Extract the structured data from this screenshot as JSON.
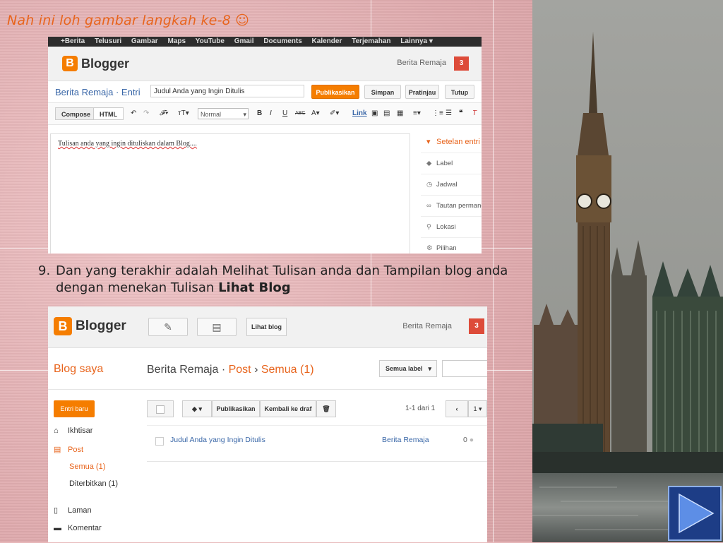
{
  "slide": {
    "heading": "Nah ini loh gambar langkah ke-8 ☺",
    "step_number": "9.",
    "step_text": "Dan yang terakhir adalah Melihat Tulisan anda dan Tampilan blog anda dengan menekan Tulisan ",
    "step_emphasis": "Lihat Blog"
  },
  "editor_shot": {
    "gbar": [
      "+Berita",
      "Telusuri",
      "Gambar",
      "Maps",
      "YouTube",
      "Gmail",
      "Documents",
      "Kalender",
      "Terjemahan",
      "Lainnya ▾"
    ],
    "logo_text": "Blogger",
    "logo_letter": "B",
    "user": "Berita Remaja",
    "notif_count": "3",
    "breadcrumb": "Berita Remaja · Entri",
    "title_value": "Judul Anda yang Ingin Ditulis",
    "btn_publish": "Publikasikan",
    "btn_save": "Simpan",
    "btn_preview": "Pratinjau",
    "btn_close": "Tutup",
    "mode_compose": "Compose",
    "mode_html": "HTML",
    "font_select": "Normal",
    "link_label": "Link",
    "body_text": "Tulisan anda yang ingin ditulis­kan dalam Blog....",
    "settings": {
      "header": "Setelan entri",
      "items": [
        "Label",
        "Jadwal",
        "Tautan permanen",
        "Lokasi",
        "Pilihan"
      ]
    }
  },
  "dashboard_shot": {
    "logo_text": "Blogger",
    "logo_letter": "B",
    "view_blog": "Lihat blog",
    "user": "Berita Remaja",
    "notif_count": "3",
    "blog_saya": "Blog saya",
    "crumb_blog": "Berita Remaja",
    "crumb_sep": "·",
    "crumb_post": "Post",
    "crumb_arrow": "›",
    "crumb_all": "Semua (1)",
    "label_filter": "Semua label",
    "new_post": "Entri baru",
    "nav": {
      "overview": "Ikhtisar",
      "post": "Post",
      "all": "Semua (1)",
      "published": "Diterbitkan (1)",
      "pages": "Laman",
      "comments": "Komentar"
    },
    "toolbar": {
      "publish": "Publikasikan",
      "revert": "Kembali ke draf"
    },
    "pager": "1-1 dari 1",
    "pager_page": "1",
    "post_row": {
      "title": "Judul Anda yang Ingin Ditulis",
      "author": "Berita Remaja",
      "comments": "0"
    }
  },
  "colors": {
    "accent": "#f57d00",
    "heading": "#e8641c",
    "link": "#3b68a8",
    "notif": "#dd4b39",
    "nav_button": "#1d3d86"
  }
}
